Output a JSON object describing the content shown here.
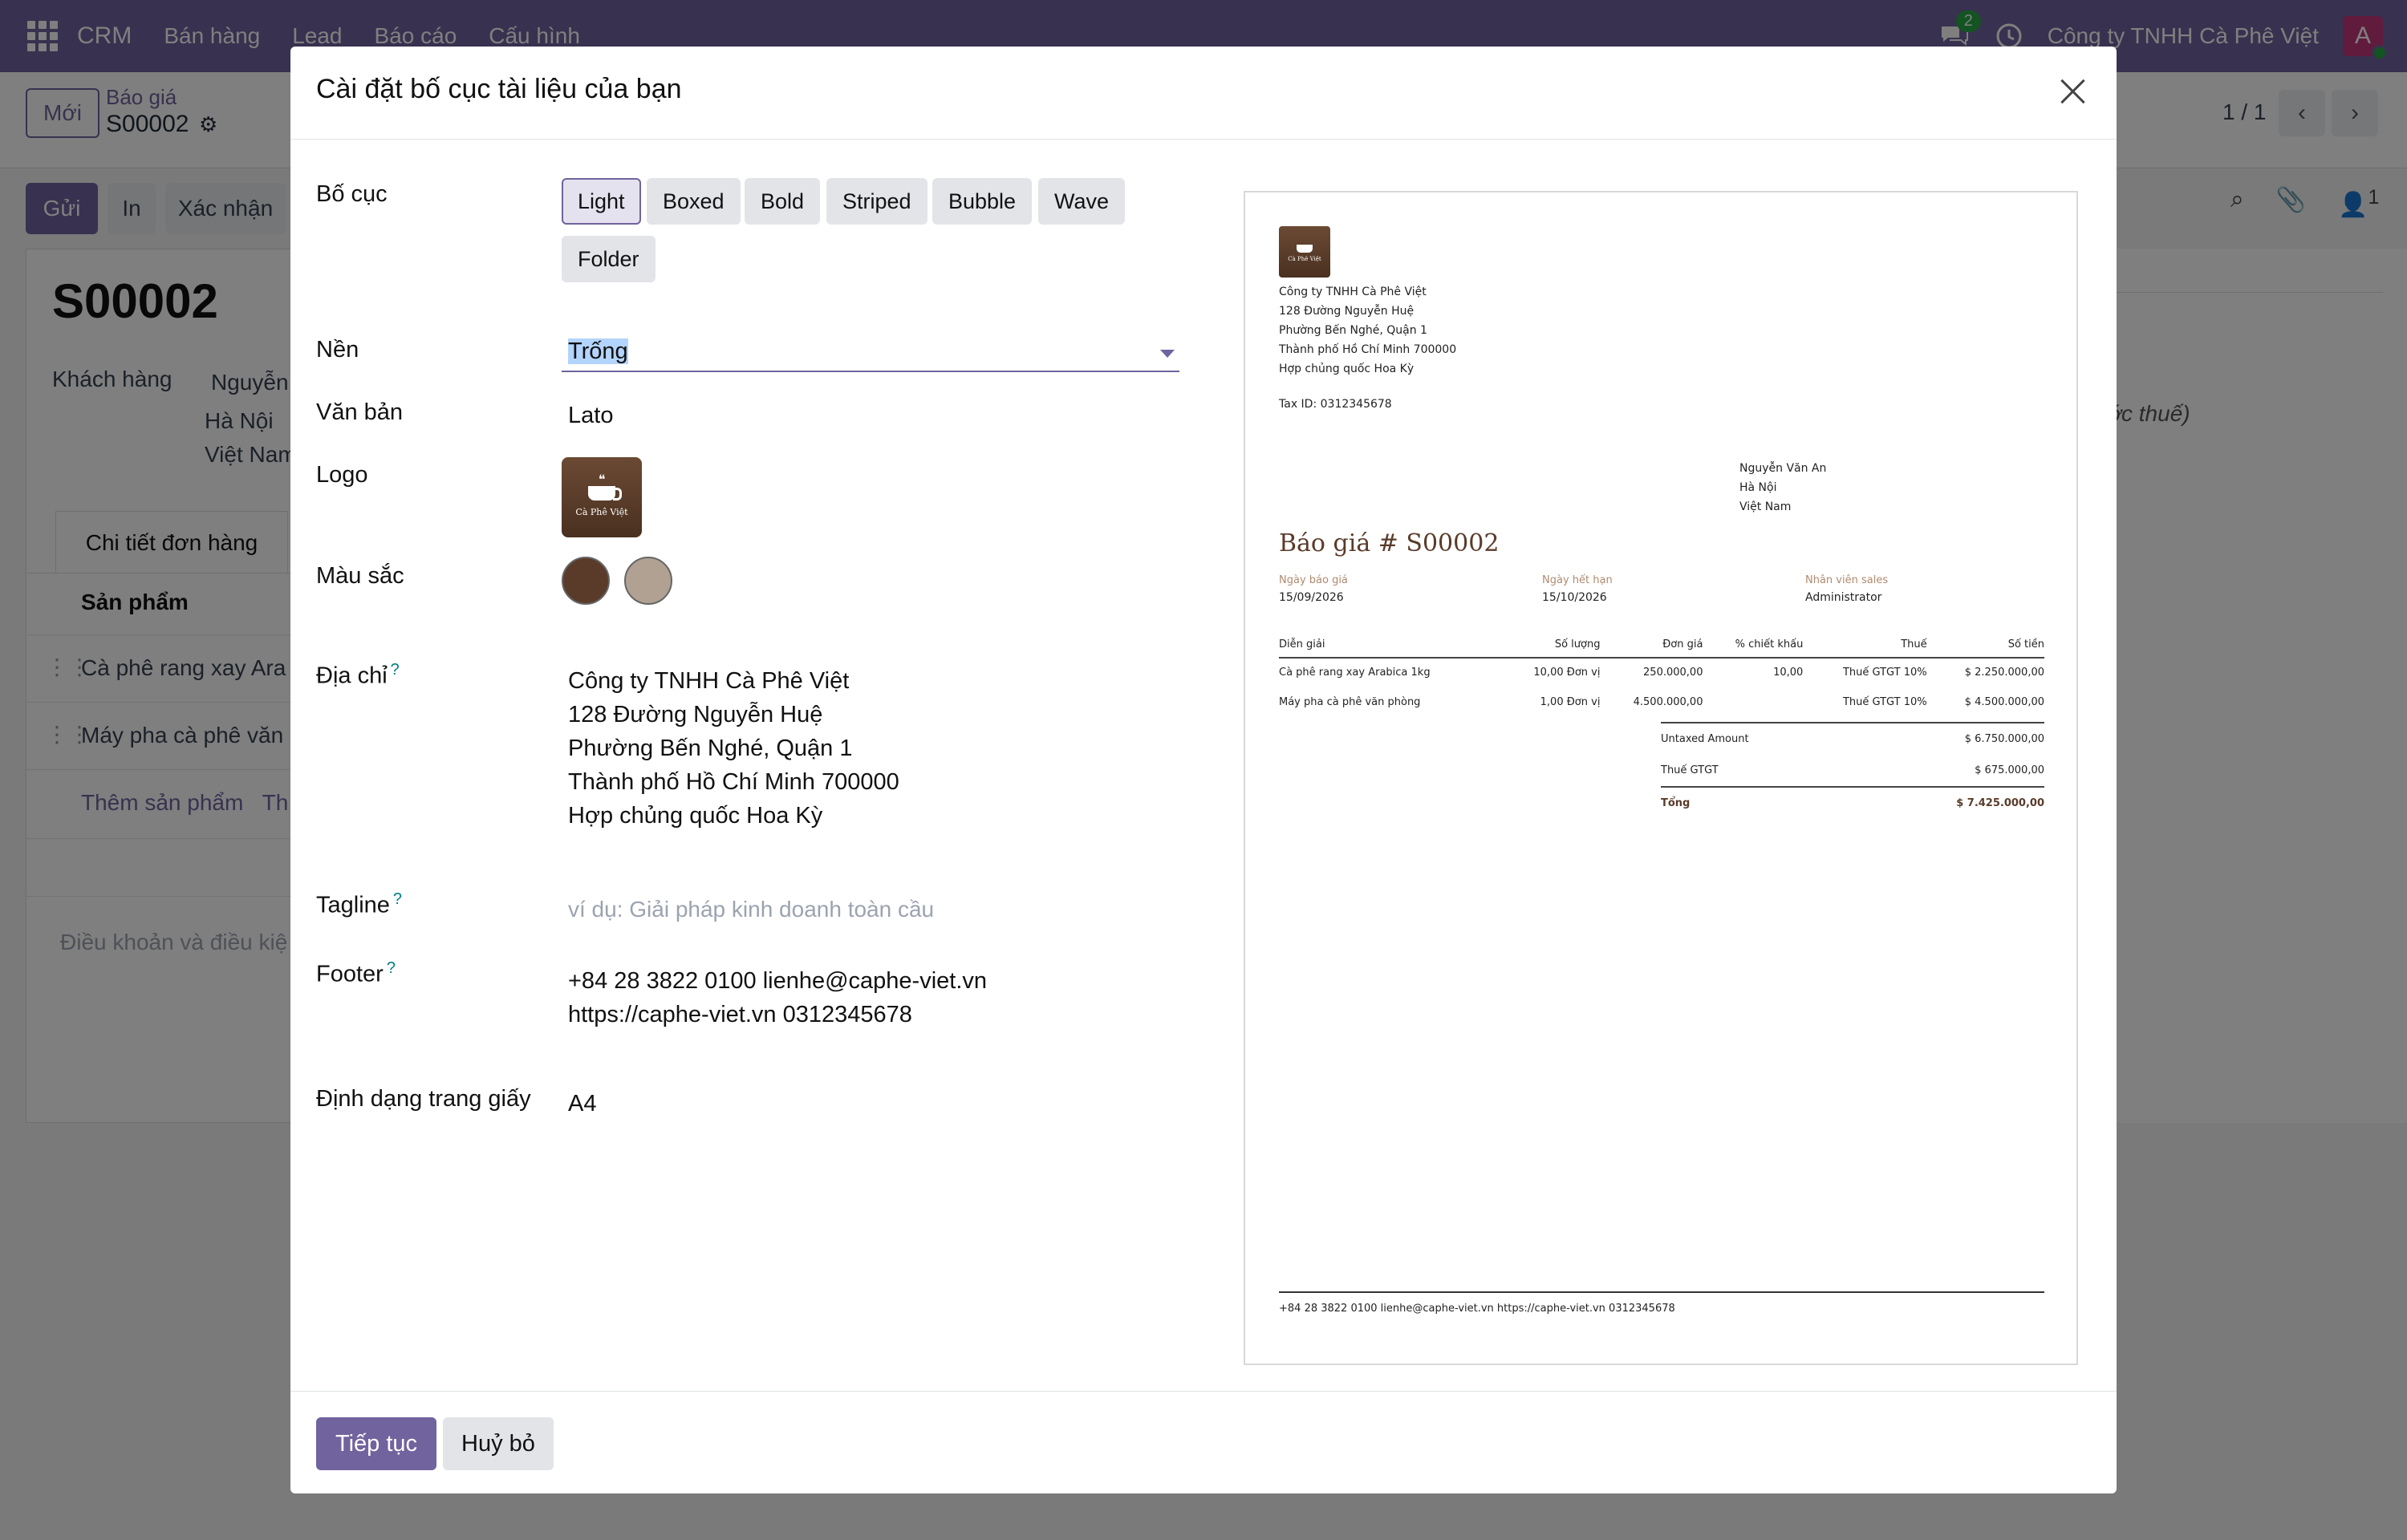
{
  "navbar": {
    "brand": "CRM",
    "menu": [
      "Bán hàng",
      "Lead",
      "Báo cáo",
      "Cấu hình"
    ],
    "chat_count": "2",
    "company": "Công ty TNHH Cà Phê Việt",
    "avatar_letter": "A"
  },
  "control_panel": {
    "new_label": "Mới",
    "breadcrumb_parent": "Báo giá",
    "breadcrumb_current": "S00002",
    "pager": "1 / 1"
  },
  "status_bar": {
    "send_label": "Gửi",
    "print_label": "In",
    "confirm_label": "Xác nhận",
    "follower_count": "1"
  },
  "form": {
    "title": "S00002",
    "customer_label": "Khách hàng",
    "customer_name": "Nguyễn",
    "customer_city": "Hà Nội",
    "customer_country": "Việt Nam",
    "tab_order_lines": "Chi tiết đơn hàng",
    "col_product": "Sản phẩm",
    "lines": [
      "Cà phê rang xay Ara",
      "Máy pha cà phê văn"
    ],
    "add_product": "Thêm sản phẩm",
    "add_section_partial": "Th",
    "terms_placeholder": "Điều khoản và điều kiệ",
    "right_note_1": "rước thuế)",
    "right_note_2": ")"
  },
  "modal": {
    "title": "Cài đặt bố cục tài liệu của bạn",
    "fields": {
      "layout_label": "Bố cục",
      "background_label": "Nền",
      "font_label": "Văn bản",
      "logo_label": "Logo",
      "colors_label": "Màu sắc",
      "address_label": "Địa chỉ",
      "tagline_label": "Tagline",
      "footer_label": "Footer",
      "paper_label": "Định dạng trang giấy"
    },
    "help_mark": "?",
    "layouts": [
      "Light",
      "Boxed",
      "Bold",
      "Striped",
      "Bubble",
      "Wave",
      "Folder"
    ],
    "active_layout": "Light",
    "background_value": "Trống",
    "font_value": "Lato",
    "logo_text": "Cà Phê Việt",
    "colors": [
      "#5a3b2a",
      "#b0a192"
    ],
    "address_lines": [
      "Công ty TNHH Cà Phê Việt",
      "128 Đường Nguyễn Huệ",
      "Phường Bến Nghé, Quận 1",
      "Thành phố Hồ Chí Minh 700000",
      "Hợp chủng quốc Hoa Kỳ"
    ],
    "tagline_placeholder": "ví dụ: Giải pháp kinh doanh toàn cầu",
    "footer_lines": [
      "+84 28 3822 0100 lienhe@caphe-viet.vn",
      "https://caphe-viet.vn 0312345678"
    ],
    "paper_value": "A4",
    "continue_label": "Tiếp tục",
    "cancel_label": "Huỷ bỏ"
  },
  "preview": {
    "company_lines": [
      "Công ty TNHH Cà Phê Việt",
      "128 Đường Nguyễn Huệ",
      "Phường Bến Nghé, Quận 1",
      "Thành phố Hồ Chí Minh 700000",
      "Hợp chủng quốc Hoa Kỳ"
    ],
    "tax_id": "Tax ID: 0312345678",
    "customer_lines": [
      "Nguyễn Văn An",
      "Hà Nội",
      "Việt Nam"
    ],
    "doc_title": "Báo giá # S00002",
    "info": [
      {
        "key": "Ngày báo giá",
        "value": "15/09/2026"
      },
      {
        "key": "Ngày hết hạn",
        "value": "15/10/2026"
      },
      {
        "key": "Nhân viên sales",
        "value": "Administrator"
      }
    ],
    "table_headers": [
      "Diễn giải",
      "Số lượng",
      "Đơn giá",
      "% chiết khấu",
      "Thuế",
      "Số tiền"
    ],
    "rows": [
      [
        "Cà phê rang xay Arabica 1kg",
        "10,00 Đơn vị",
        "250.000,00",
        "10,00",
        "Thuế GTGT 10%",
        "$ 2.250.000,00"
      ],
      [
        "Máy pha cà phê văn phòng",
        "1,00 Đơn vị",
        "4.500.000,00",
        "",
        "Thuế GTGT 10%",
        "$ 4.500.000,00"
      ]
    ],
    "totals": [
      {
        "label": "Untaxed Amount",
        "value": "$ 6.750.000,00"
      },
      {
        "label": "Thuế GTGT",
        "value": "$ 675.000,00"
      },
      {
        "label": "Tổng",
        "value": "$ 7.425.000,00"
      }
    ],
    "footer": "+84 28 3822 0100 lienhe@caphe-viet.vn https://caphe-viet.vn 0312345678"
  }
}
